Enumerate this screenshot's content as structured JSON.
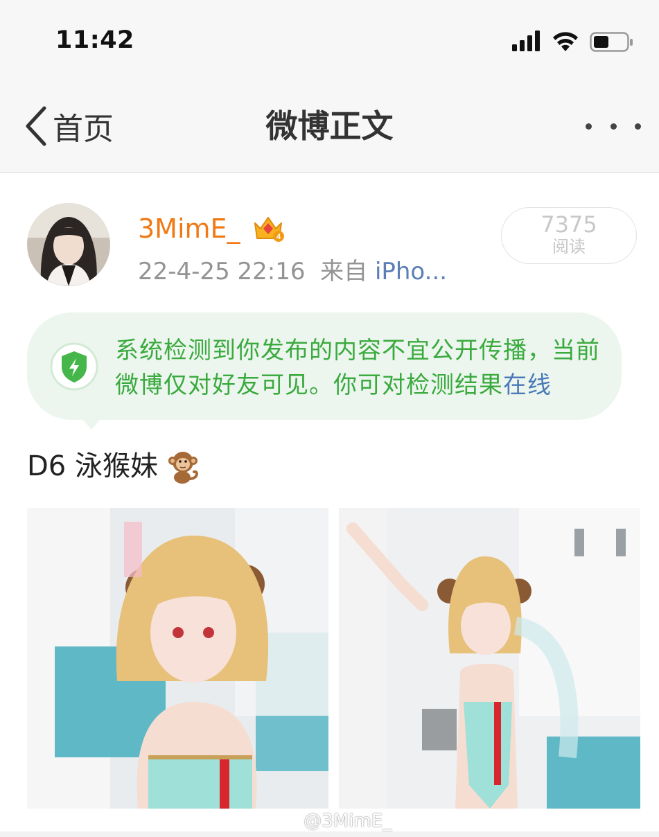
{
  "status_bar": {
    "time": "11:42"
  },
  "nav": {
    "back_label": "首页",
    "title": "微博正文"
  },
  "post": {
    "author": "3MimE_",
    "timestamp": "22-4-25 22:16",
    "source_prefix": "来自",
    "source": "iPho...",
    "read_count": "7375",
    "read_label": "阅读",
    "notice_text": "系统检测到你发布的内容不宜公开传播，当前微博仅对好友可见。你可对检测结果",
    "notice_link": "在线",
    "text": "D6 泳猴妹",
    "watermark": "@3MimE_"
  },
  "colors": {
    "username": "#ef7a16",
    "notice_bg": "#ecf6ee",
    "notice_text": "#3aaa3e",
    "link": "#4a79b8"
  }
}
